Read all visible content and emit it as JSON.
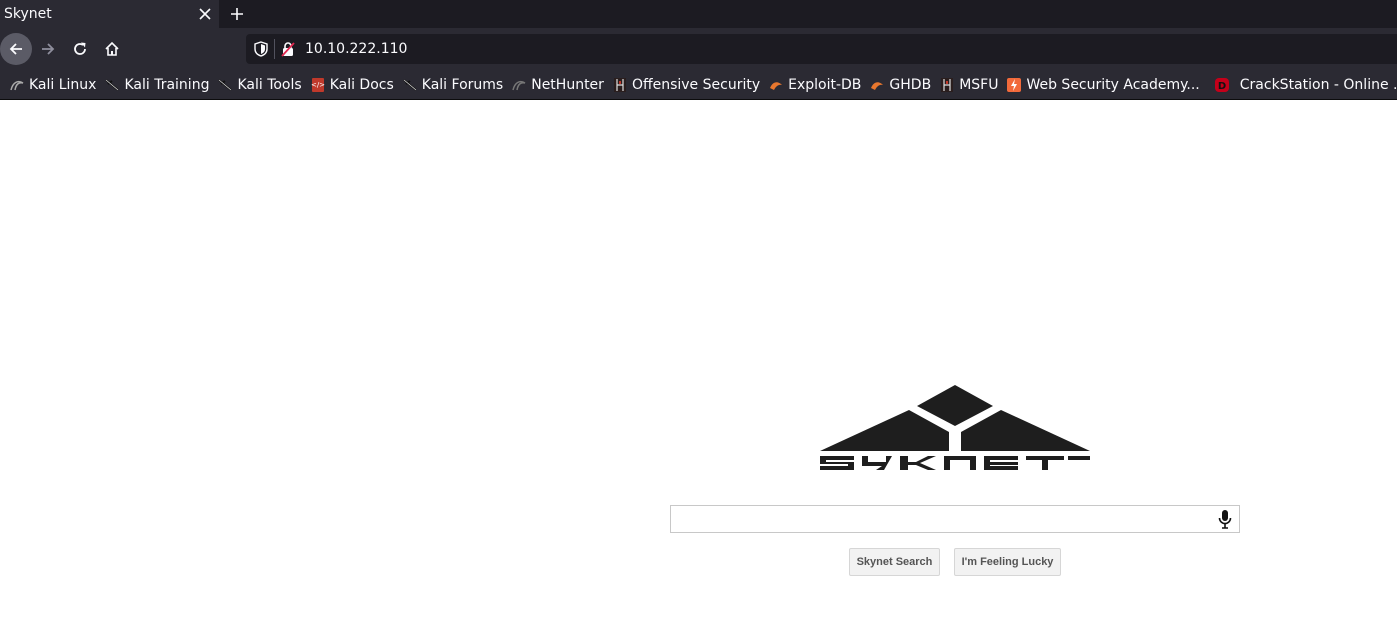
{
  "browser": {
    "tab": {
      "title": "Skynet",
      "close_icon": "close-icon"
    },
    "new_tab_icon": "plus-icon",
    "nav": {
      "back_icon": "back-arrow-icon",
      "forward_icon": "forward-arrow-icon",
      "reload_icon": "reload-icon",
      "home_icon": "home-icon"
    },
    "url": "10.10.222.110"
  },
  "bookmarks": [
    {
      "label": "Kali Linux",
      "icon": "kali-dragon-icon"
    },
    {
      "label": "Kali Training",
      "icon": "kali-dragon-icon"
    },
    {
      "label": "Kali Tools",
      "icon": "kali-dragon-icon"
    },
    {
      "label": "Kali Docs",
      "icon": "kali-docs-icon"
    },
    {
      "label": "Kali Forums",
      "icon": "kali-dragon-icon"
    },
    {
      "label": "NetHunter",
      "icon": "nethunter-icon"
    },
    {
      "label": "Offensive Security",
      "icon": "offsec-icon"
    },
    {
      "label": "Exploit-DB",
      "icon": "exploitdb-icon"
    },
    {
      "label": "GHDB",
      "icon": "exploitdb-icon"
    },
    {
      "label": "MSFU",
      "icon": "offsec-icon"
    },
    {
      "label": "Web Security Academy...",
      "icon": "portswigger-icon"
    },
    {
      "label": "CrackStation - Online ...",
      "icon": "crackstation-icon"
    }
  ],
  "page": {
    "logo_text": "SKYNET",
    "search": {
      "value": "",
      "placeholder": ""
    },
    "search_button_label": "Skynet Search",
    "lucky_button_label": "I'm Feeling Lucky"
  },
  "colors": {
    "chrome_dark": "#1c1b22",
    "chrome": "#2b2a33",
    "logo": "#1e1e1e",
    "accent_red": "#e22850"
  }
}
